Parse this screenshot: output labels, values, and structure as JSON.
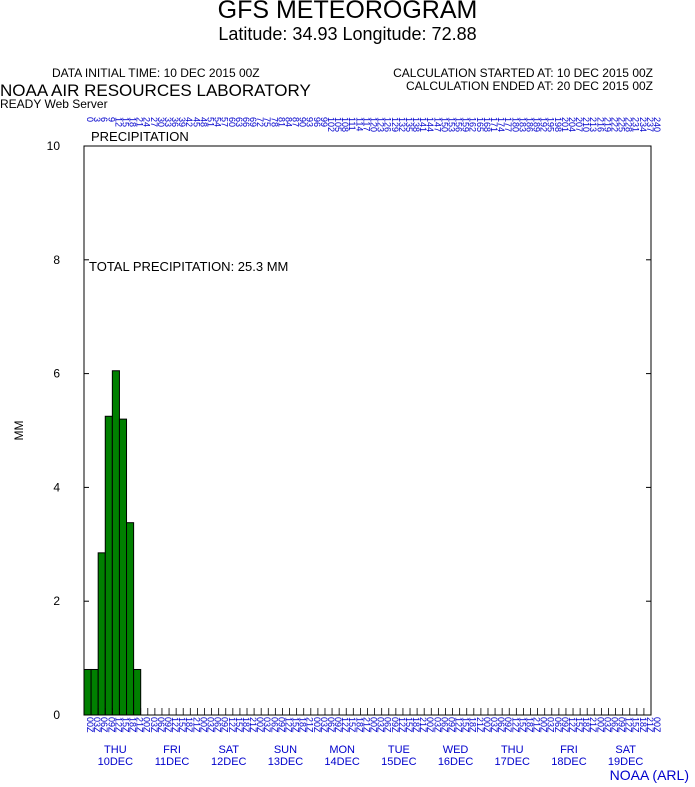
{
  "header": {
    "title": "GFS METEOROGRAM",
    "subtitle": "Latitude: 34.93 Longitude:  72.88",
    "data_initial_time": "DATA INITIAL TIME: 10 DEC 2015 00Z",
    "calc_started": "CALCULATION STARTED AT: 10 DEC 2015 00Z",
    "calc_ended": "CALCULATION ENDED AT: 20 DEC 2015 00Z",
    "org": "NOAA AIR RESOURCES LABORATORY",
    "server": "READY Web Server"
  },
  "footer": "NOAA (ARL)",
  "colors": {
    "bar": "#008000",
    "date_text": "#0000cc"
  },
  "chart_data": {
    "type": "bar",
    "title": "PRECIPITATION",
    "annotation": "TOTAL PRECIPITATION:  25.3 MM",
    "ylabel": "MM",
    "ylim": [
      0,
      10
    ],
    "yticks": [
      "0",
      "2",
      "4",
      "6",
      "8",
      "10"
    ],
    "x_unit": "forecast hour",
    "xlim": [
      0,
      240
    ],
    "bar_width_hours": 3,
    "x": [
      0,
      3,
      6,
      9,
      12,
      15,
      18,
      21,
      24,
      27,
      30,
      33,
      36,
      39,
      42,
      45,
      48,
      51,
      54,
      57,
      60,
      63,
      66,
      69,
      72,
      75,
      78,
      81,
      84,
      87,
      90,
      93,
      96,
      99,
      102,
      105,
      108,
      111,
      114,
      117,
      120,
      123,
      126,
      129,
      132,
      135,
      138,
      141,
      144,
      147,
      150,
      153,
      156,
      159,
      162,
      165,
      168,
      171,
      174,
      177,
      180,
      183,
      186,
      189,
      192,
      195,
      198,
      201,
      204,
      207,
      210,
      213,
      216,
      219,
      222,
      225,
      228,
      231,
      234,
      237,
      240
    ],
    "values": [
      0.8,
      0.8,
      2.85,
      5.25,
      6.05,
      5.2,
      3.38,
      0.8,
      0,
      0,
      0,
      0,
      0,
      0,
      0,
      0,
      0,
      0,
      0,
      0,
      0,
      0,
      0,
      0,
      0,
      0,
      0,
      0,
      0,
      0,
      0,
      0,
      0,
      0,
      0,
      0,
      0,
      0,
      0,
      0,
      0,
      0,
      0,
      0,
      0,
      0,
      0,
      0,
      0,
      0,
      0,
      0,
      0,
      0,
      0,
      0,
      0,
      0,
      0,
      0,
      0,
      0,
      0,
      0,
      0,
      0,
      0,
      0,
      0,
      0,
      0,
      0,
      0,
      0,
      0,
      0,
      0,
      0,
      0,
      0,
      0
    ],
    "top_tick_labels": [
      "0",
      "3",
      "6",
      "9",
      "12",
      "15",
      "18",
      "21",
      "24",
      "27",
      "30",
      "33",
      "36",
      "39",
      "42",
      "45",
      "48",
      "51",
      "54",
      "57",
      "60",
      "63",
      "66",
      "69",
      "72",
      "75",
      "78",
      "81",
      "84",
      "87",
      "90",
      "93",
      "96",
      "99",
      "102",
      "105",
      "108",
      "111",
      "114",
      "117",
      "120",
      "123",
      "126",
      "129",
      "132",
      "135",
      "138",
      "141",
      "144",
      "147",
      "150",
      "153",
      "156",
      "159",
      "162",
      "165",
      "168",
      "171",
      "174",
      "177",
      "180",
      "183",
      "186",
      "189",
      "192",
      "195",
      "198",
      "201",
      "204",
      "207",
      "210",
      "213",
      "216",
      "219",
      "222",
      "225",
      "228",
      "231",
      "234",
      "237",
      "240"
    ],
    "bottom_tick_labels": [
      "00Z",
      "03Z",
      "06Z",
      "09Z",
      "12Z",
      "15Z",
      "18Z",
      "21Z",
      "00Z",
      "03Z",
      "06Z",
      "09Z",
      "12Z",
      "15Z",
      "18Z",
      "21Z",
      "00Z",
      "03Z",
      "06Z",
      "09Z",
      "12Z",
      "15Z",
      "18Z",
      "21Z",
      "00Z",
      "03Z",
      "06Z",
      "09Z",
      "12Z",
      "15Z",
      "18Z",
      "21Z",
      "00Z",
      "03Z",
      "06Z",
      "09Z",
      "12Z",
      "15Z",
      "18Z",
      "21Z",
      "00Z",
      "03Z",
      "06Z",
      "09Z",
      "12Z",
      "15Z",
      "18Z",
      "21Z",
      "00Z",
      "03Z",
      "06Z",
      "09Z",
      "12Z",
      "15Z",
      "18Z",
      "21Z",
      "00Z",
      "03Z",
      "06Z",
      "09Z",
      "12Z",
      "15Z",
      "18Z",
      "21Z",
      "00Z",
      "03Z",
      "06Z",
      "09Z",
      "12Z",
      "15Z",
      "18Z",
      "21Z",
      "00Z",
      "03Z",
      "06Z",
      "09Z",
      "12Z",
      "15Z",
      "18Z",
      "21Z",
      "00Z"
    ],
    "days": [
      {
        "weekday": "THU",
        "date": "10DEC"
      },
      {
        "weekday": "FRI",
        "date": "11DEC"
      },
      {
        "weekday": "SAT",
        "date": "12DEC"
      },
      {
        "weekday": "SUN",
        "date": "13DEC"
      },
      {
        "weekday": "MON",
        "date": "14DEC"
      },
      {
        "weekday": "TUE",
        "date": "15DEC"
      },
      {
        "weekday": "WED",
        "date": "16DEC"
      },
      {
        "weekday": "THU",
        "date": "17DEC"
      },
      {
        "weekday": "FRI",
        "date": "18DEC"
      },
      {
        "weekday": "SAT",
        "date": "19DEC"
      }
    ]
  }
}
